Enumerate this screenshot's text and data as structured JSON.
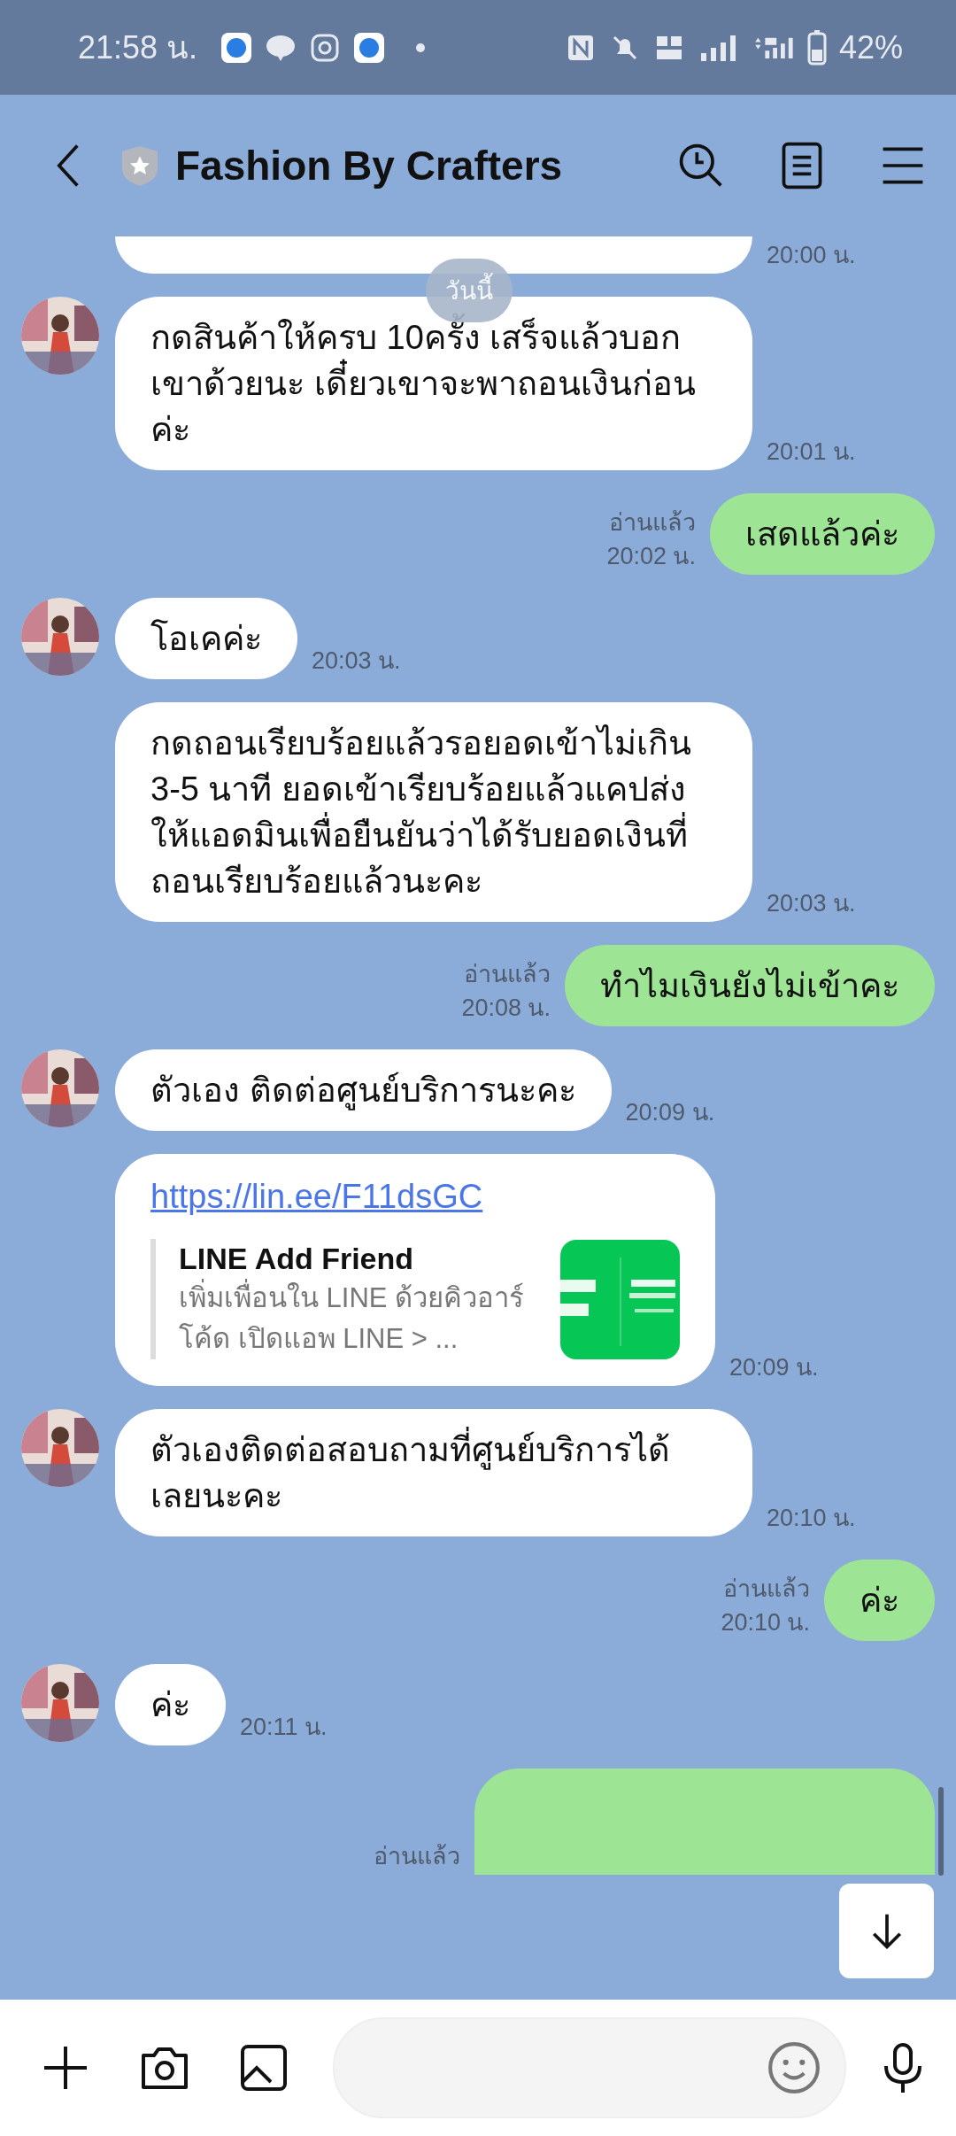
{
  "status_bar": {
    "time": "21:58 น.",
    "battery": "42%"
  },
  "header": {
    "title": "Fashion By Crafters"
  },
  "date_chip": "วันนี้",
  "messages": [
    {
      "kind": "clipped_top",
      "outgoing": false,
      "avatar": false,
      "time": "20:00 น."
    },
    {
      "kind": "text",
      "outgoing": false,
      "avatar": true,
      "text": "กดสินค้าให้ครบ 10ครั้ง เสร็จแล้วบอกเขาด้วยนะ เดี๋ยวเขาจะพาถอนเงินก่อนค่ะ",
      "time": "20:01 น."
    },
    {
      "kind": "text",
      "outgoing": true,
      "read": "อ่านแล้ว",
      "text": "เสดแล้วค่ะ",
      "time": "20:02 น."
    },
    {
      "kind": "text",
      "outgoing": false,
      "avatar": true,
      "text": "โอเคค่ะ",
      "time": "20:03 น."
    },
    {
      "kind": "text",
      "outgoing": false,
      "avatar": false,
      "text": "กดถอนเรียบร้อยแล้วรอยอดเข้าไม่เกิน 3-5 นาที ยอดเข้าเรียบร้อยแล้วแคปส่งให้แอดมินเพื่อยืนยันว่าได้รับยอดเงินที่ถอนเรียบร้อยแล้วนะคะ",
      "time": "20:03 น."
    },
    {
      "kind": "text",
      "outgoing": true,
      "read": "อ่านแล้ว",
      "text": "ทำไมเงินยังไม่เข้าคะ",
      "time": "20:08 น."
    },
    {
      "kind": "text",
      "outgoing": false,
      "avatar": true,
      "text": "ตัวเอง ติดต่อศูนย์บริการนะคะ",
      "time": "20:09 น."
    },
    {
      "kind": "link",
      "outgoing": false,
      "avatar": false,
      "url": "https://lin.ee/F11dsGC",
      "title": "LINE Add Friend",
      "description": "เพิ่มเพื่อนใน LINE ด้วยคิวอาร์โค้ด เปิดแอพ LINE > ...",
      "time": "20:09 น."
    },
    {
      "kind": "text",
      "outgoing": false,
      "avatar": true,
      "text": "ตัวเองติดต่อสอบถามที่ศูนย์บริการได้เลยนะคะ",
      "time": "20:10 น."
    },
    {
      "kind": "text",
      "outgoing": true,
      "read": "อ่านแล้ว",
      "text": "ค่ะ",
      "time": "20:10 น."
    },
    {
      "kind": "text",
      "outgoing": false,
      "avatar": true,
      "text": "ค่ะ",
      "time": "20:11 น."
    },
    {
      "kind": "clipped_bottom",
      "outgoing": true,
      "read": "อ่านแล้ว"
    }
  ]
}
